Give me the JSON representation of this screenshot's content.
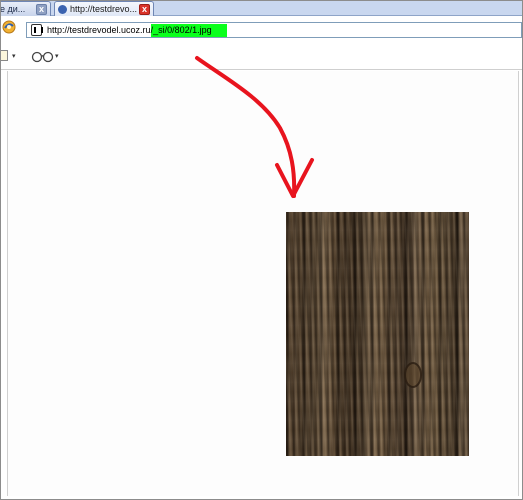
{
  "tabs": [
    {
      "label": "е ди...",
      "close": "x",
      "active": false
    },
    {
      "label": "http://testdrevo...",
      "close": "x",
      "active": true
    }
  ],
  "address_bar": {
    "url_prefix": "http://testdrevodel.ucoz.ru",
    "url_highlighted": "/_si/0/802/1.jpg"
  },
  "toolbar": {
    "dropdown_glyph": "▾"
  },
  "annotation": {
    "arrow_color": "#e8141e",
    "highlight_color": "#0aff1c"
  },
  "icons": [
    "browser-icon",
    "site-favicon-icon",
    "page-icon",
    "glasses-icon",
    "close-icon",
    "chevron-down-icon"
  ]
}
